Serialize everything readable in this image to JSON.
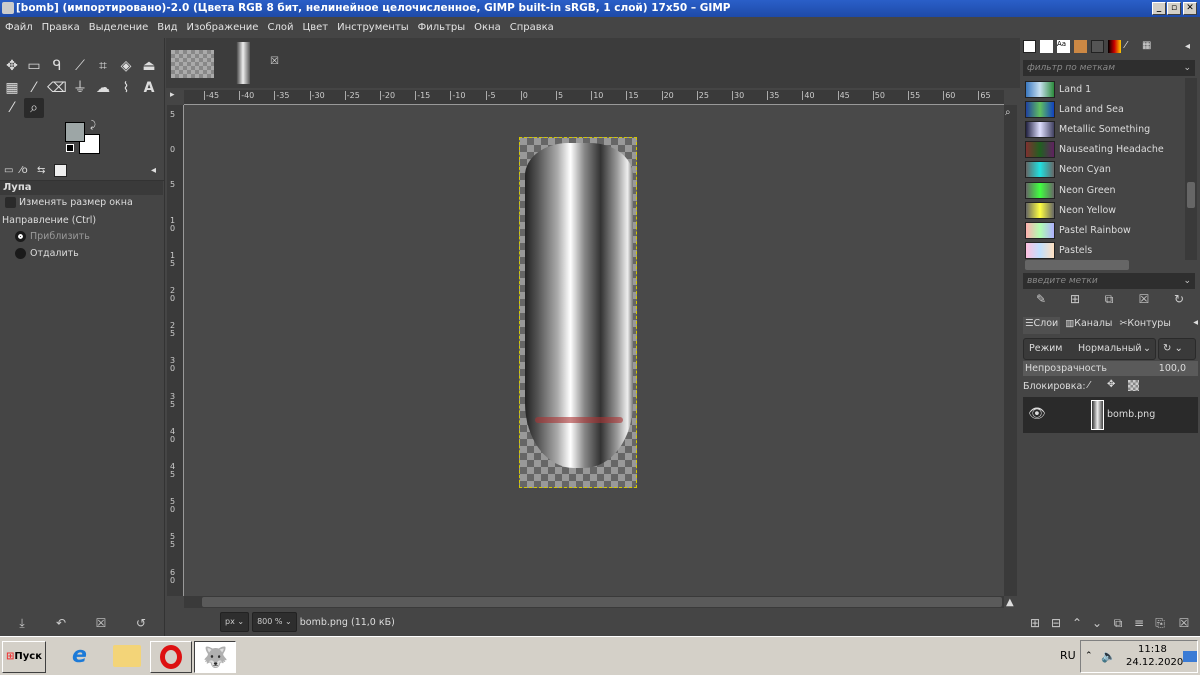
{
  "window": {
    "title": "[bomb] (импортировано)-2.0 (Цвета RGB 8 бит, нелинейное целочисленное, GIMP built-in sRGB, 1 слой) 17x50 – GIMP"
  },
  "menu": [
    "Файл",
    "Правка",
    "Выделение",
    "Вид",
    "Изображение",
    "Слой",
    "Цвет",
    "Инструменты",
    "Фильтры",
    "Окна",
    "Справка"
  ],
  "colors": {
    "foreground": "#9da6a6",
    "background": "#ffffff",
    "titlebar": "#2a5fc8"
  },
  "tool_options": {
    "title": "Лупа",
    "resize_window": "Изменять размер окна",
    "direction_label": "Направление (Ctrl)",
    "zoom_in": "Приблизить",
    "zoom_out": "Отдалить",
    "selected": "zoom_in"
  },
  "rulers": {
    "horizontal": [
      "-45",
      "-40",
      "-35",
      "-30",
      "-25",
      "-20",
      "-15",
      "-10",
      "-5",
      "0",
      "5",
      "10",
      "15",
      "20",
      "25",
      "30",
      "35",
      "40",
      "45",
      "50",
      "55",
      "60",
      "65"
    ],
    "vertical": [
      "5",
      "0",
      "5",
      "10",
      "15",
      "20",
      "25",
      "30",
      "35",
      "40",
      "45",
      "50",
      "55",
      "60"
    ]
  },
  "status": {
    "unit": "px",
    "zoom": "800 %",
    "file": "bomb.png (11,0 кБ)"
  },
  "gradients": {
    "filter_placeholder": "фильтр по меткам",
    "tags_placeholder": "введите метки",
    "items": [
      {
        "name": "Land 1",
        "colors": [
          "#3a78c0",
          "#c8e0f0",
          "#2a8a3a"
        ]
      },
      {
        "name": "Land and Sea",
        "colors": [
          "#2040a0",
          "#60c060",
          "#1040c0"
        ]
      },
      {
        "name": "Metallic Something",
        "colors": [
          "#202040",
          "#e0e0ff",
          "#404060"
        ]
      },
      {
        "name": "Nauseating Headache",
        "colors": [
          "#803030",
          "#206020",
          "#602060"
        ]
      },
      {
        "name": "Neon Cyan",
        "colors": [
          "#666",
          "#20e0e0",
          "#666"
        ]
      },
      {
        "name": "Neon Green",
        "colors": [
          "#666",
          "#40ff40",
          "#666"
        ]
      },
      {
        "name": "Neon Yellow",
        "colors": [
          "#666",
          "#ffff40",
          "#666"
        ]
      },
      {
        "name": "Pastel Rainbow",
        "colors": [
          "#ffb0b0",
          "#b0ffb0",
          "#b0b0ff"
        ]
      },
      {
        "name": "Pastels",
        "colors": [
          "#ffc0e0",
          "#c0e0ff",
          "#ffe0c0"
        ]
      }
    ]
  },
  "layers": {
    "tabs": [
      "Слои",
      "Каналы",
      "Контуры"
    ],
    "mode_label": "Режим",
    "mode_value": "Нормальный",
    "opacity_label": "Непрозрачность",
    "opacity_value": "100,0",
    "lock_label": "Блокировка:",
    "items": [
      {
        "name": "bomb.png",
        "visible": true
      }
    ]
  },
  "taskbar": {
    "start": "Пуск",
    "lang": "RU",
    "time": "11:18",
    "date": "24.12.2020"
  }
}
